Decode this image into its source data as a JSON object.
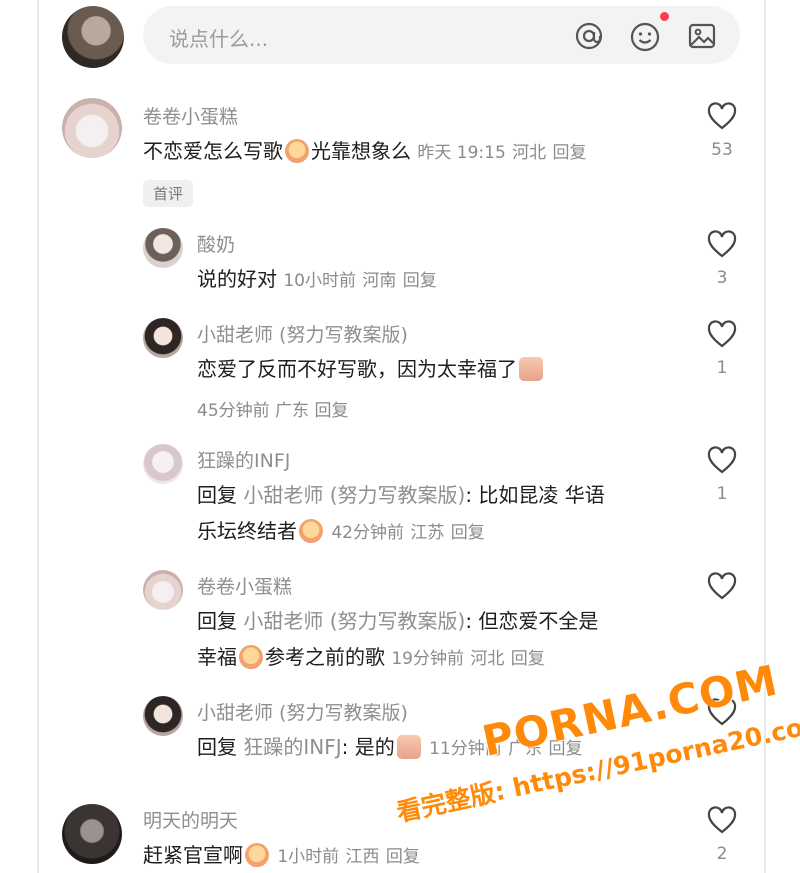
{
  "input": {
    "placeholder": "说点什么..."
  },
  "comments": [
    {
      "name": "卷卷小蛋糕",
      "text_before": "不恋爱怎么写歌",
      "text_after": "光靠想象么",
      "time": "昨天 19:15",
      "location": "河北",
      "reply": "回复",
      "likes": "53",
      "badge": "首评"
    },
    {
      "name": "酸奶",
      "text": "说的好对",
      "time": "10小时前",
      "location": "河南",
      "reply": "回复",
      "likes": "3"
    },
    {
      "name": "小甜老师 (努力写教案版)",
      "text": "恋爱了反而不好写歌，因为太幸福了",
      "time": "45分钟前",
      "location": "广东",
      "reply": "回复",
      "likes": "1"
    },
    {
      "name": "狂躁的INFJ",
      "reply_prefix": "回复",
      "reply_to": "小甜老师 (努力写教案版)",
      "text_line1": ": 比如昆凌 华语",
      "text_line2": "乐坛终结者",
      "time": "42分钟前",
      "location": "江苏",
      "reply": "回复",
      "likes": "1"
    },
    {
      "name": "卷卷小蛋糕",
      "reply_prefix": "回复",
      "reply_to": "小甜老师 (努力写教案版)",
      "text_line1": ": 但恋爱不全是",
      "text_line2_before": "幸福",
      "text_line2_after": "参考之前的歌",
      "time": "19分钟前",
      "location": "河北",
      "reply": "回复",
      "likes": ""
    },
    {
      "name": "小甜老师 (努力写教案版)",
      "reply_prefix": "回复",
      "reply_to": "狂躁的INFJ",
      "text": ": 是的",
      "time": "11分钟前",
      "location": "广东",
      "reply": "回复",
      "likes": ""
    },
    {
      "name": "明天的明天",
      "text": "赶紧官宣啊",
      "time": "1小时前",
      "location": "江西",
      "reply": "回复",
      "likes": "2"
    }
  ],
  "watermark": {
    "main": "PORNA.COM",
    "sub": "看完整版: https://91porna20.com"
  },
  "colors": {
    "notification_dot": "#ff3a4f",
    "watermark": "#ff8a0a"
  }
}
